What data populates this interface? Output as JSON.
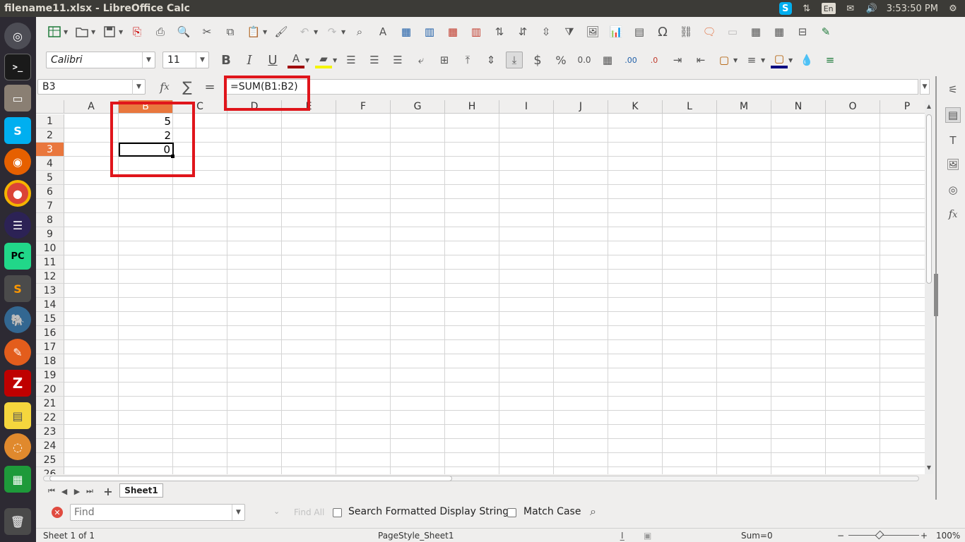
{
  "window": {
    "title": "filename11.xlsx - LibreOffice Calc"
  },
  "tray": {
    "lang": "En",
    "clock": "3:53:50 PM"
  },
  "launcher": {
    "items": [
      "dash",
      "terminal",
      "files",
      "skype",
      "firefox",
      "chrome",
      "eclipse",
      "pycharm",
      "sublime",
      "pgadmin",
      "draw",
      "filezilla",
      "notes",
      "blender",
      "calc",
      "trash"
    ]
  },
  "format": {
    "font_name": "Calibri",
    "font_size": "11"
  },
  "formula": {
    "cell_ref": "B3",
    "content": "=SUM(B1:B2)"
  },
  "sheet": {
    "columns": [
      "A",
      "B",
      "C",
      "D",
      "E",
      "F",
      "G",
      "H",
      "I",
      "J",
      "K",
      "L",
      "M",
      "N",
      "O",
      "P"
    ],
    "rows": [
      "1",
      "2",
      "3",
      "4",
      "5",
      "6",
      "7",
      "8",
      "9",
      "10",
      "11",
      "12",
      "13",
      "14",
      "15",
      "16",
      "17",
      "18",
      "19",
      "20",
      "21",
      "22",
      "23",
      "24",
      "25",
      "26"
    ],
    "cells": {
      "B1": "5",
      "B2": "2",
      "B3": "0"
    },
    "selected_column": "B",
    "selected_row": "3"
  },
  "tabs": {
    "sheet1": "Sheet1"
  },
  "findbar": {
    "placeholder": "Find",
    "find_all": "Find All",
    "formatted": "Search Formatted Display String",
    "match_case": "Match Case"
  },
  "status": {
    "sheet": "Sheet 1 of 1",
    "page_style": "PageStyle_Sheet1",
    "sum": "Sum=0",
    "zoom": "100%"
  },
  "colors": {
    "accent": "#e9773d",
    "highlight": "#e0151b"
  }
}
